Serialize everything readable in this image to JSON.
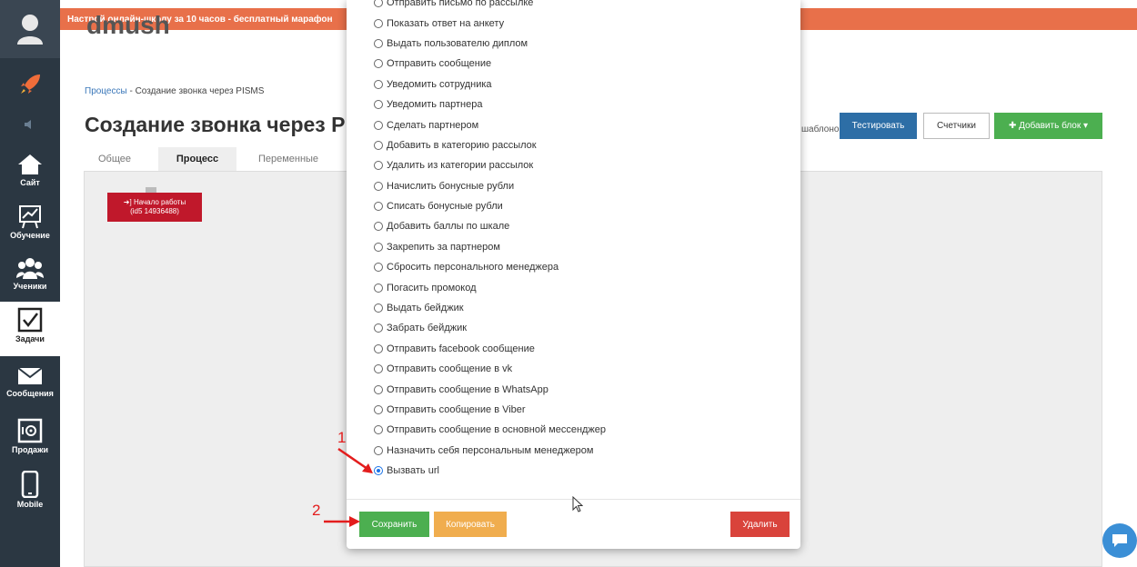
{
  "banner": {
    "text": "Настрой онлайн-школу за 10 часов - бесплатный марафон"
  },
  "school": {
    "name": "dmush"
  },
  "breadcrumb": {
    "link": "Процессы",
    "separator": " - ",
    "current": "Создание звонка через PISMS"
  },
  "page": {
    "title": "Создание звонка через PISMS"
  },
  "tabs": [
    {
      "label": "Общее"
    },
    {
      "label": "Процесс"
    },
    {
      "label": "Переменные"
    }
  ],
  "toolbar": {
    "partial_text": "шаблоном",
    "test_label": "Тестировать",
    "counters_label": "Счетчики",
    "add_block_label": "Добавить блок"
  },
  "start_block": {
    "line1": "Начало работы",
    "line2": "(id5 14936488)"
  },
  "sidebar": {
    "items": [
      {
        "label": "Сайт"
      },
      {
        "label": "Обучение"
      },
      {
        "label": "Ученики"
      },
      {
        "label": "Задачи"
      },
      {
        "label": "Сообщения"
      },
      {
        "label": "Продажи"
      },
      {
        "label": "Mobile"
      }
    ]
  },
  "modal": {
    "options": [
      {
        "label": "Отправить письмо по рассылке"
      },
      {
        "label": "Показать ответ на анкету"
      },
      {
        "label": "Выдать пользователю диплом"
      },
      {
        "label": "Отправить сообщение"
      },
      {
        "label": "Уведомить сотрудника"
      },
      {
        "label": "Уведомить партнера"
      },
      {
        "label": "Сделать партнером"
      },
      {
        "label": "Добавить в категорию рассылок"
      },
      {
        "label": "Удалить из категории рассылок"
      },
      {
        "label": "Начислить бонусные рубли"
      },
      {
        "label": "Списать бонусные рубли"
      },
      {
        "label": "Добавить баллы по шкале"
      },
      {
        "label": "Закрепить за партнером"
      },
      {
        "label": "Сбросить персонального менеджера"
      },
      {
        "label": "Погасить промокод"
      },
      {
        "label": "Выдать бейджик"
      },
      {
        "label": "Забрать бейджик"
      },
      {
        "label": "Отправить facebook сообщение"
      },
      {
        "label": "Отправить сообщение в vk"
      },
      {
        "label": "Отправить сообщение в WhatsApp"
      },
      {
        "label": "Отправить сообщение в Viber"
      },
      {
        "label": "Отправить сообщение в основной мессенджер"
      },
      {
        "label": "Назначить себя персональным менеджером"
      },
      {
        "label": "Вызвать url"
      }
    ],
    "selected_option": "Вызвать url",
    "save_label": "Сохранить",
    "copy_label": "Копировать",
    "delete_label": "Удалить"
  },
  "annotations": {
    "step1": "1",
    "step2": "2"
  },
  "colors": {
    "sidebar": "#2b3742",
    "banner": "#e8704a",
    "primary": "#2d6ea6",
    "success": "#4caf50",
    "warning": "#f0ad4e",
    "danger": "#d9433b",
    "start_block": "#c0182b",
    "annotation": "#e31d1d"
  }
}
